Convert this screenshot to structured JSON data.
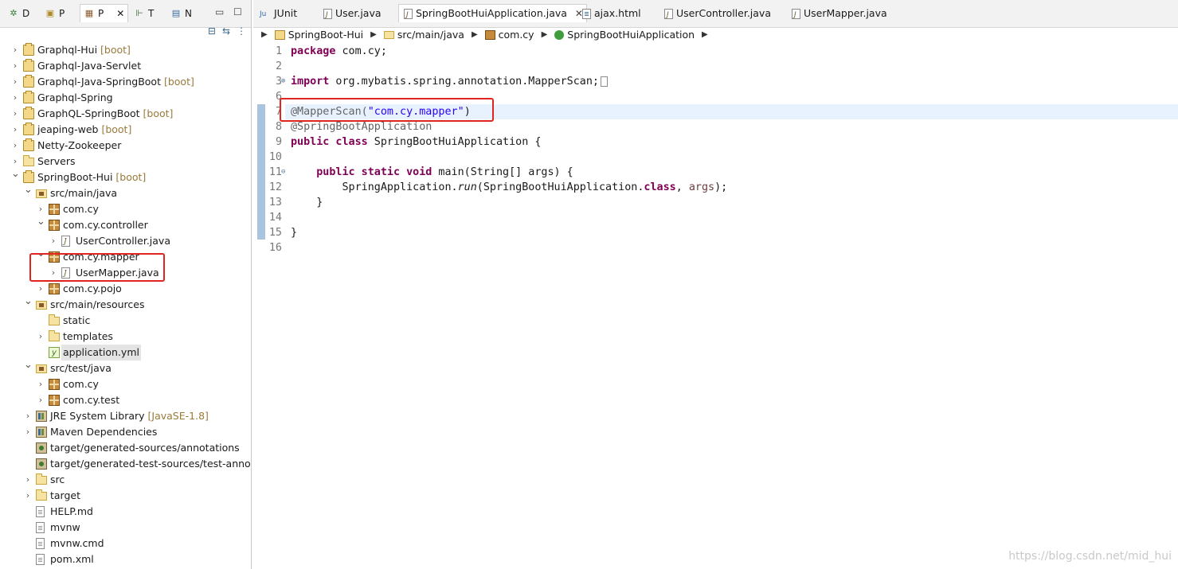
{
  "left_panel": {
    "tabs": [
      {
        "label": "D",
        "icon": "debug-icon"
      },
      {
        "label": "P",
        "icon": "project-explorer-icon"
      },
      {
        "label": "P",
        "icon": "package-explorer-icon",
        "closable": true
      },
      {
        "label": "T",
        "icon": "type-hierarchy-icon"
      },
      {
        "label": "N",
        "icon": "navigator-icon"
      }
    ],
    "window_buttons": {
      "minimize": "▭",
      "maximize": "☐"
    },
    "toolbar": {
      "collapse_all": "⊟",
      "link_editor": "⇆",
      "view_menu": "⋮"
    },
    "tree": [
      {
        "label": "Graphql-Hui",
        "deco": "[boot]",
        "indent": 0,
        "arrow": ">",
        "icon": "project-icon"
      },
      {
        "label": "Graphql-Java-Servlet",
        "deco": "",
        "indent": 0,
        "arrow": ">",
        "icon": "project-icon"
      },
      {
        "label": "Graphql-Java-SpringBoot",
        "deco": "[boot]",
        "indent": 0,
        "arrow": ">",
        "icon": "project-icon"
      },
      {
        "label": "Graphql-Spring",
        "deco": "",
        "indent": 0,
        "arrow": ">",
        "icon": "project-icon"
      },
      {
        "label": "GraphQL-SpringBoot",
        "deco": "[boot]",
        "indent": 0,
        "arrow": ">",
        "icon": "project-icon"
      },
      {
        "label": "jeaping-web",
        "deco": "[boot]",
        "indent": 0,
        "arrow": ">",
        "icon": "project-icon"
      },
      {
        "label": "Netty-Zookeeper",
        "deco": "",
        "indent": 0,
        "arrow": ">",
        "icon": "project-icon"
      },
      {
        "label": "Servers",
        "deco": "",
        "indent": 0,
        "arrow": ">",
        "icon": "folder-icon"
      },
      {
        "label": "SpringBoot-Hui",
        "deco": "[boot]",
        "indent": 0,
        "arrow": "v",
        "icon": "project-icon"
      },
      {
        "label": "src/main/java",
        "deco": "",
        "indent": 1,
        "arrow": "v",
        "icon": "source-folder-icon"
      },
      {
        "label": "com.cy",
        "deco": "",
        "indent": 2,
        "arrow": ">",
        "icon": "package-icon"
      },
      {
        "label": "com.cy.controller",
        "deco": "",
        "indent": 2,
        "arrow": "v",
        "icon": "package-icon"
      },
      {
        "label": "UserController.java",
        "deco": "",
        "indent": 3,
        "arrow": ">",
        "icon": "java-file-icon"
      },
      {
        "label": "com.cy.mapper",
        "deco": "",
        "indent": 2,
        "arrow": "v",
        "icon": "package-icon"
      },
      {
        "label": "UserMapper.java",
        "deco": "",
        "indent": 3,
        "arrow": ">",
        "icon": "java-interface-file-icon"
      },
      {
        "label": "com.cy.pojo",
        "deco": "",
        "indent": 2,
        "arrow": ">",
        "icon": "package-icon"
      },
      {
        "label": "src/main/resources",
        "deco": "",
        "indent": 1,
        "arrow": "v",
        "icon": "source-folder-icon"
      },
      {
        "label": "static",
        "deco": "",
        "indent": 2,
        "arrow": "",
        "icon": "folder-icon"
      },
      {
        "label": "templates",
        "deco": "",
        "indent": 2,
        "arrow": ">",
        "icon": "folder-icon"
      },
      {
        "label": "application.yml",
        "deco": "",
        "indent": 2,
        "arrow": "",
        "icon": "yml-file-icon",
        "selected": true
      },
      {
        "label": "src/test/java",
        "deco": "",
        "indent": 1,
        "arrow": "v",
        "icon": "source-folder-icon"
      },
      {
        "label": "com.cy",
        "deco": "",
        "indent": 2,
        "arrow": ">",
        "icon": "package-icon"
      },
      {
        "label": "com.cy.test",
        "deco": "",
        "indent": 2,
        "arrow": ">",
        "icon": "package-icon"
      },
      {
        "label": "JRE System Library",
        "deco": "[JavaSE-1.8]",
        "indent": 1,
        "arrow": ">",
        "icon": "library-icon"
      },
      {
        "label": "Maven Dependencies",
        "deco": "",
        "indent": 1,
        "arrow": ">",
        "icon": "library-icon"
      },
      {
        "label": "target/generated-sources/annotations",
        "deco": "",
        "indent": 1,
        "arrow": "",
        "icon": "generated-folder-icon"
      },
      {
        "label": "target/generated-test-sources/test-annotat",
        "deco": "",
        "indent": 1,
        "arrow": "",
        "icon": "generated-folder-icon"
      },
      {
        "label": "src",
        "deco": "",
        "indent": 1,
        "arrow": ">",
        "icon": "folder-icon"
      },
      {
        "label": "target",
        "deco": "",
        "indent": 1,
        "arrow": ">",
        "icon": "folder-icon"
      },
      {
        "label": "HELP.md",
        "deco": "",
        "indent": 1,
        "arrow": "",
        "icon": "file-icon"
      },
      {
        "label": "mvnw",
        "deco": "",
        "indent": 1,
        "arrow": "",
        "icon": "file-icon"
      },
      {
        "label": "mvnw.cmd",
        "deco": "",
        "indent": 1,
        "arrow": "",
        "icon": "file-icon"
      },
      {
        "label": "pom.xml",
        "deco": "",
        "indent": 1,
        "arrow": "",
        "icon": "file-icon"
      }
    ]
  },
  "editor": {
    "tabs": [
      {
        "label": "JUnit",
        "icon": "junit-icon",
        "active": false
      },
      {
        "label": "User.java",
        "icon": "java-file-icon",
        "active": false
      },
      {
        "label": "SpringBootHuiApplication.java",
        "icon": "java-file-icon",
        "active": true,
        "close": "✕"
      },
      {
        "label": "ajax.html",
        "icon": "html-file-icon",
        "active": false
      },
      {
        "label": "UserController.java",
        "icon": "java-file-icon",
        "active": false
      },
      {
        "label": "UserMapper.java",
        "icon": "java-file-icon",
        "active": false
      }
    ],
    "breadcrumb": [
      "SpringBoot-Hui",
      "src/main/java",
      "com.cy",
      "SpringBootHuiApplication"
    ],
    "line_numbers": [
      "1",
      "2",
      "3",
      "6",
      "7",
      "8",
      "9",
      "10",
      "11",
      "12",
      "13",
      "14",
      "15",
      "16"
    ],
    "code": {
      "l1_kw": "package",
      "l1_rest": " com.cy;",
      "l3_kw": "import",
      "l3_rest": " org.mybatis.spring.annotation.MapperScan;",
      "l7_ann": "@MapperScan(",
      "l7_str": "\"com.cy.mapper\"",
      "l7_end": ")",
      "l8_ann": "@SpringBootApplication",
      "l9_kw": "public class",
      "l9_rest": " SpringBootHuiApplication {",
      "l11_kw": "    public static void",
      "l11_rest": " main(String[] args) {",
      "l12_a": "        SpringApplication.",
      "l12_run": "run",
      "l12_b": "(SpringBootHuiApplication.",
      "l12_cls": "class",
      "l12_c": ", ",
      "l12_args": "args",
      "l12_d": ");",
      "l13": "    }",
      "l15": "}"
    }
  },
  "watermark": "https://blog.csdn.net/mid_hui",
  "colors": {
    "highlight_box": "#e0241f",
    "keyword": "#7f0055",
    "string": "#2a00ff",
    "annotation": "#646464"
  }
}
